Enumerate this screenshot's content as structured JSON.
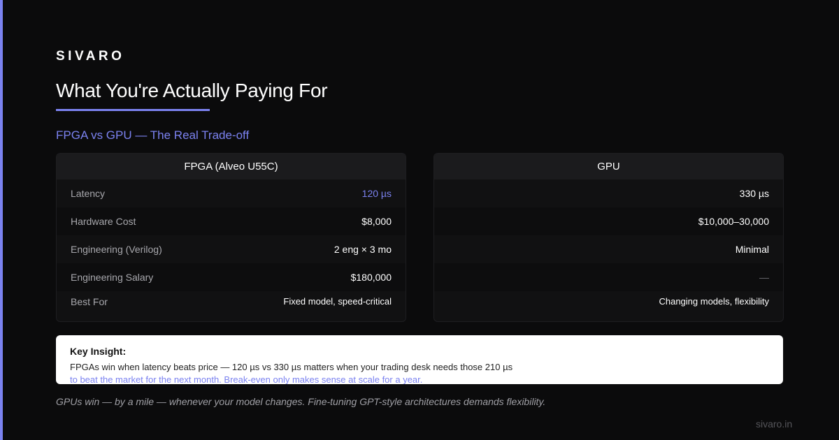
{
  "brand": "SIVARO",
  "title": "What You're Actually Paying For",
  "subtitle": "FPGA vs GPU — The Real Trade-off",
  "colors": {
    "accent": "#7b82f0",
    "background": "#0b0b0c",
    "card": "#111112",
    "card_header": "#1b1b1d"
  },
  "fpga": {
    "header": "FPGA (Alveo U55C)",
    "rows": [
      {
        "label": "Latency",
        "value": "120 µs"
      },
      {
        "label": "Hardware Cost",
        "value": "$8,000"
      },
      {
        "label": "Engineering (Verilog)",
        "value": "2 eng × 3 mo"
      },
      {
        "label": "Engineering Salary",
        "value": "$180,000"
      },
      {
        "label": "Best For",
        "value": "Fixed model, speed-critical"
      }
    ]
  },
  "gpu": {
    "header": "GPU",
    "rows": [
      {
        "value": "330 µs"
      },
      {
        "value": "$10,000–30,000"
      },
      {
        "value": "Minimal"
      },
      {
        "value": "—"
      },
      {
        "value": "Changing models, flexibility"
      }
    ]
  },
  "insight": {
    "title": "Key Insight:",
    "line1": "FPGAs win when latency beats price — 120 µs vs 330 µs matters when your trading desk needs those 210 µs",
    "line2": "to beat the market for the next month. Break-even only makes sense at scale for a year."
  },
  "footnote": "GPUs win — by a mile — whenever your model changes. Fine-tuning GPT-style architectures demands flexibility.",
  "domain": "sivaro.in"
}
